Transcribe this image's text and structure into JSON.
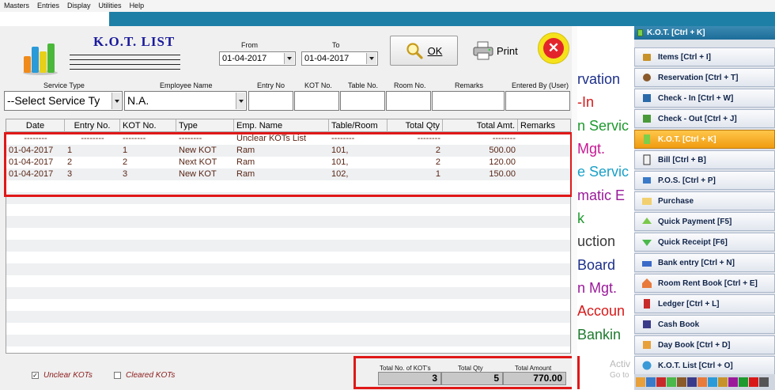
{
  "menubar": {
    "items": [
      "Masters",
      "Entries",
      "Display",
      "Utilities",
      "Help"
    ]
  },
  "form": {
    "title": "K.O.T. LIST",
    "from_label": "From",
    "to_label": "To",
    "from_date": "01-04-2017",
    "to_date": "01-04-2017",
    "ok_label": "OK",
    "print_label": "Print",
    "close_glyph": "✕"
  },
  "filters": {
    "headers": [
      "Service Type",
      "Employee Name",
      "Entry No",
      "KOT No.",
      "Table No.",
      "Room No.",
      "Remarks",
      "Entered By (User)"
    ],
    "service_type_value": "--Select Service Ty",
    "employee_value": "N.A.",
    "entry_no": "",
    "kot_no": "",
    "table_no": "",
    "room_no": "",
    "remarks": "",
    "entered_by": ""
  },
  "grid": {
    "columns": [
      "Date",
      "Entry No.",
      "KOT No.",
      "Type",
      "Emp. Name",
      "Table/Room",
      "Total Qty",
      "Total Amt.",
      "Remarks"
    ],
    "separator_row": [
      "--------",
      "--------",
      "--------",
      "--------",
      "Unclear KOTs List",
      "--------",
      "--------",
      "--------",
      ""
    ],
    "rows": [
      [
        "01-04-2017",
        "1",
        "1",
        "New KOT",
        "Ram",
        "101,",
        "2",
        "500.00",
        ""
      ],
      [
        "01-04-2017",
        "2",
        "2",
        "Next KOT",
        "Ram",
        "101,",
        "2",
        "120.00",
        ""
      ],
      [
        "01-04-2017",
        "3",
        "3",
        "New KOT",
        "Ram",
        "102,",
        "1",
        "150.00",
        ""
      ]
    ]
  },
  "options": {
    "unclear_label": "Unclear KOTs",
    "unclear_checked": true,
    "unclear_mark": "✓",
    "cleared_label": "Cleared KOTs",
    "cleared_checked": false
  },
  "totals": {
    "kot_count_label": "Total No. of KOT's",
    "qty_label": "Total Qty",
    "amount_label": "Total Amount",
    "kot_count": "3",
    "qty": "5",
    "amount": "770.00"
  },
  "background_text": {
    "lines": [
      {
        "text": "rvation",
        "color": "#1d2f8a"
      },
      {
        "text": "-In",
        "color": "#d81818"
      },
      {
        "text": "n Servic",
        "color": "#1e9a2e"
      },
      {
        "text": "Mgt.",
        "color": "#c81894"
      },
      {
        "text": "e Servic",
        "color": "#1aa0c8"
      },
      {
        "text": "matic E",
        "color": "#9a1a9a"
      },
      {
        "text": "k",
        "color": "#1e9a2e"
      },
      {
        "text": "uction",
        "color": "#3a3a3a"
      },
      {
        "text": "Board",
        "color": "#1d2f8a"
      },
      {
        "text": "n Mgt.",
        "color": "#9a1a9a"
      },
      {
        "text": "Accoun",
        "color": "#d81818"
      },
      {
        "text": "Bankin",
        "color": "#1e7a2e"
      }
    ]
  },
  "side_panel": {
    "header": "K.O.T. [Ctrl + K]",
    "items": [
      {
        "label": "Items [Ctrl + I]",
        "icon": "items-icon",
        "color": "#c8922a"
      },
      {
        "label": "Reservation [Ctrl + T]",
        "icon": "reservation-icon",
        "color": "#8a5a2a"
      },
      {
        "label": "Check - In [Ctrl + W]",
        "icon": "check-in-icon",
        "color": "#2a6aaa"
      },
      {
        "label": "Check - Out [Ctrl + J]",
        "icon": "check-out-icon",
        "color": "#4a9a3a"
      },
      {
        "label": "K.O.T. [Ctrl + K]",
        "icon": "kot-icon",
        "color": "#7ccf4a",
        "active": true
      },
      {
        "label": "Bill [Ctrl + B]",
        "icon": "bill-icon",
        "color": "#f2f2f2"
      },
      {
        "label": "P.O.S. [Ctrl + P]",
        "icon": "pos-icon",
        "color": "#3a7ac8"
      },
      {
        "label": "Purchase",
        "icon": "purchase-icon",
        "color": "#f2d070"
      },
      {
        "label": "Quick Payment [F5]",
        "icon": "quick-payment-icon",
        "color": "#7ac84a"
      },
      {
        "label": "Quick Receipt [F6]",
        "icon": "quick-receipt-icon",
        "color": "#4ab84a"
      },
      {
        "label": "Bank entry [Ctrl + N]",
        "icon": "bank-entry-icon",
        "color": "#3a6ac8"
      },
      {
        "label": "Room Rent Book [Ctrl + E]",
        "icon": "room-rent-icon",
        "color": "#e87a3a"
      },
      {
        "label": "Ledger [Ctrl + L]",
        "icon": "ledger-icon",
        "color": "#c82a2a"
      },
      {
        "label": "Cash Book",
        "icon": "cash-book-icon",
        "color": "#3a3a8a"
      },
      {
        "label": "Day Book [Ctrl + D]",
        "icon": "day-book-icon",
        "color": "#e8a03a"
      },
      {
        "label": "K.O.T. List [Ctrl + O]",
        "icon": "kot-list-icon",
        "color": "#3a9ad8"
      }
    ]
  },
  "watermark": {
    "line1": "Activ",
    "line2": "Go to"
  }
}
